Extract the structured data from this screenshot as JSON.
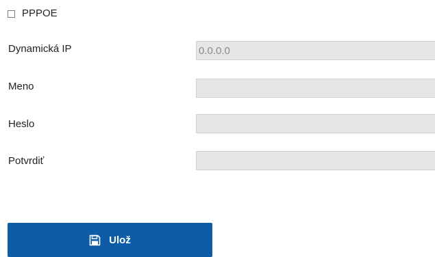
{
  "pppoe": {
    "label": "PPPOE",
    "checked": false
  },
  "fields": [
    {
      "label": "Dynamická IP",
      "value": "0.0.0.0"
    },
    {
      "label": "Meno",
      "value": ""
    },
    {
      "label": "Heslo",
      "value": ""
    },
    {
      "label": "Potvrdiť",
      "value": ""
    }
  ],
  "save_button": {
    "label": "Ulož",
    "icon": "save-icon"
  },
  "colors": {
    "button_bg": "#0e5ca7",
    "input_bg": "#e6e6e6"
  }
}
